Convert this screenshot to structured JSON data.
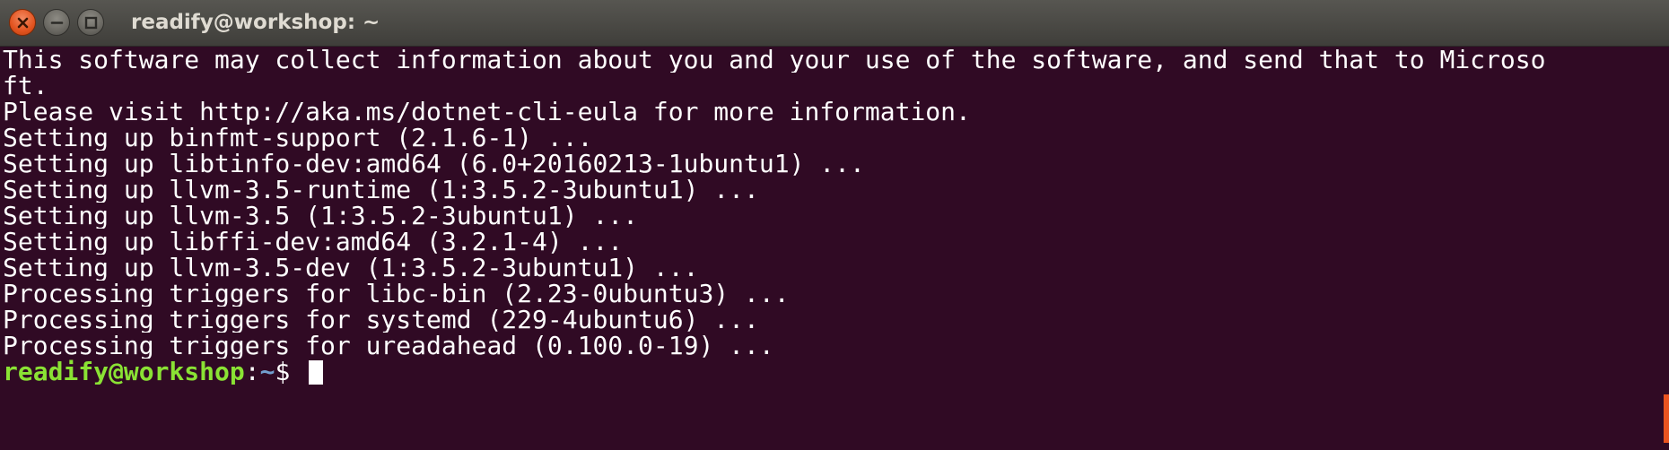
{
  "window": {
    "title": "readify@workshop: ~",
    "controls": {
      "close_icon": "close-icon",
      "minimize_icon": "minimize-icon",
      "maximize_icon": "maximize-icon"
    }
  },
  "terminal": {
    "lines": [
      "This software may collect information about you and your use of the software, and send that to Microso",
      "ft.",
      "Please visit http://aka.ms/dotnet-cli-eula for more information.",
      "Setting up binfmt-support (2.1.6-1) ...",
      "Setting up libtinfo-dev:amd64 (6.0+20160213-1ubuntu1) ...",
      "Setting up llvm-3.5-runtime (1:3.5.2-3ubuntu1) ...",
      "Setting up llvm-3.5 (1:3.5.2-3ubuntu1) ...",
      "Setting up libffi-dev:amd64 (3.2.1-4) ...",
      "Setting up llvm-3.5-dev (1:3.5.2-3ubuntu1) ...",
      "Processing triggers for libc-bin (2.23-0ubuntu3) ...",
      "Processing triggers for systemd (229-4ubuntu6) ...",
      "Processing triggers for ureadahead (0.100.0-19) ..."
    ],
    "prompt": {
      "user_host": "readify@workshop",
      "colon": ":",
      "path": "~",
      "symbol": "$ "
    }
  },
  "colors": {
    "background": "#300a24",
    "text": "#ffffff",
    "prompt_user": "#8ae234",
    "prompt_path": "#729fcf",
    "accent": "#e95420"
  }
}
